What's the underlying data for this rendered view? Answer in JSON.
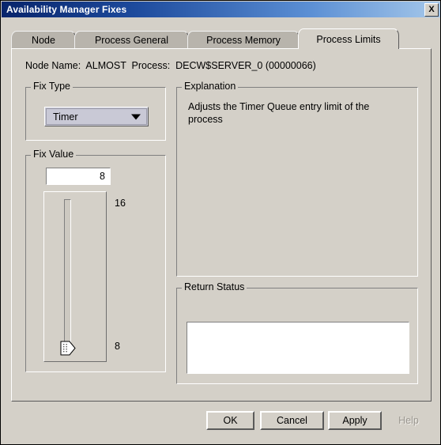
{
  "window": {
    "title": "Availability Manager Fixes",
    "close_icon": "close-icon",
    "close_label": "X"
  },
  "tabs": [
    {
      "label": "Node",
      "active": false
    },
    {
      "label": "Process General",
      "active": false
    },
    {
      "label": "Process Memory",
      "active": false
    },
    {
      "label": "Process Limits",
      "active": true
    }
  ],
  "header": {
    "node_line": "Node Name:  ALMOST  Process:  DECW$SERVER_0 (00000066)"
  },
  "fix_type": {
    "group_title": "Fix Type",
    "selected": "Timer",
    "arrow_icon": "chevron-down-icon"
  },
  "fix_value": {
    "group_title": "Fix Value",
    "value": "8",
    "slider": {
      "max_label": "16",
      "min_label": "8",
      "min": 8,
      "max": 16,
      "current": 8,
      "thumb_icon": "slider-thumb-icon"
    }
  },
  "explanation": {
    "group_title": "Explanation",
    "text": "Adjusts the Timer Queue entry limit of the process"
  },
  "return_status": {
    "group_title": "Return Status",
    "text": ""
  },
  "buttons": {
    "ok": "OK",
    "cancel": "Cancel",
    "apply": "Apply",
    "help": "Help"
  },
  "colors": {
    "dialog_face": "#d4d0c8",
    "title_dark": "#08246b",
    "title_light": "#a6c8ea",
    "combo_face": "#c9c9d6",
    "tab_inactive": "#b8b4ac"
  }
}
